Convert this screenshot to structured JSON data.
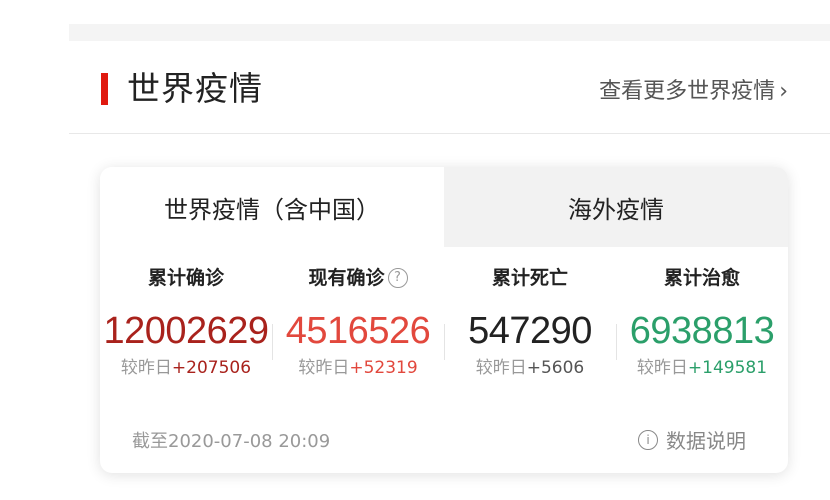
{
  "section": {
    "title": "世界疫情",
    "more_link": "查看更多世界疫情",
    "more_chevron": "›"
  },
  "tabs": [
    {
      "label": "世界疫情（含中国）",
      "active": true
    },
    {
      "label": "海外疫情",
      "active": false
    }
  ],
  "stats": [
    {
      "label": "累计确诊",
      "value": "12002629",
      "delta_prefix": "较昨日",
      "delta": "+207506",
      "color": "#a9221c"
    },
    {
      "label": "现有确诊",
      "value": "4516526",
      "delta_prefix": "较昨日",
      "delta": "+52319",
      "color": "#e2483d",
      "help_icon": "?"
    },
    {
      "label": "累计死亡",
      "value": "547290",
      "delta_prefix": "较昨日",
      "delta": "+5606",
      "color": "#222222"
    },
    {
      "label": "累计治愈",
      "value": "6938813",
      "delta_prefix": "较昨日",
      "delta": "+149581",
      "color": "#2b9f6a"
    }
  ],
  "cutoff_text": "截至2020-07-08 20:09",
  "data_note": {
    "label": "数据说明",
    "icon": "i"
  }
}
